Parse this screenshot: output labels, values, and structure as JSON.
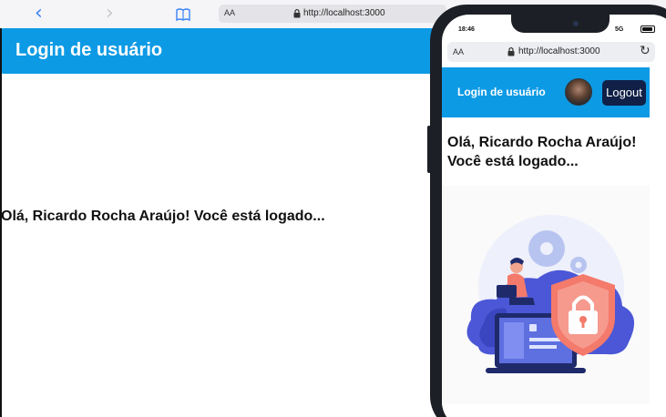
{
  "desktop": {
    "address": {
      "text_size": "AA",
      "url": "http://localhost:3000"
    },
    "header": {
      "title": "Login de usuário"
    },
    "greeting": "Olá, Ricardo Rocha Araújo! Você está logado..."
  },
  "phone": {
    "status": {
      "time": "18:46",
      "network": "5G"
    },
    "address": {
      "text_size": "AA",
      "url": "http://localhost:3000"
    },
    "header": {
      "title": "Login de usuário",
      "logout_label": "Logout"
    },
    "greeting": "Olá, Ricardo Rocha Araújo! Você está logado..."
  },
  "icons": [
    "back-icon",
    "forward-icon",
    "bookmarks-icon",
    "lock-icon",
    "reload-icon",
    "avatar"
  ],
  "colors": {
    "header": "#0d9ae5",
    "logout_button": "#102047",
    "shield": "#f47a6b",
    "cloud": "#4b57d6"
  }
}
